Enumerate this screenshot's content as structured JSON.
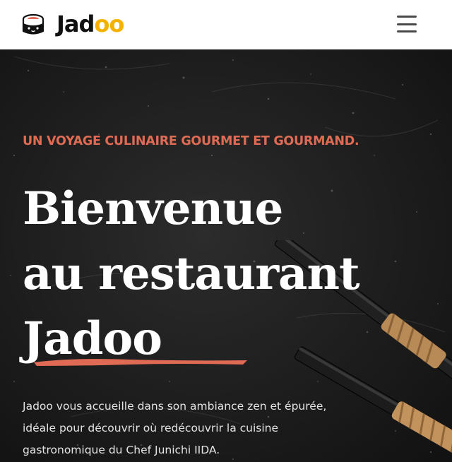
{
  "header": {
    "brand_main": "Jad",
    "brand_highlight": "oo",
    "logo_icon": "sushi-mascot-icon",
    "menu_icon": "hamburger-menu-icon"
  },
  "hero": {
    "tagline": "UN VOYAGE CULINAIRE GOURMET ET GOURMAND.",
    "title_line1": "Bienvenue",
    "title_line2": "au restaurant",
    "title_line3": "Jadoo",
    "description": "Jadoo vous accueille dans son ambiance zen et épurée, idéale pour découvrir où redécouvrir la cuisine gastronomique du Chef Junichi IIDA.",
    "decoration_icon": "chopsticks-icon"
  },
  "colors": {
    "accent": "#e06b55",
    "brand_yellow": "#f5b100",
    "background": "#1b1b1b",
    "text_light": "#ffffff"
  }
}
